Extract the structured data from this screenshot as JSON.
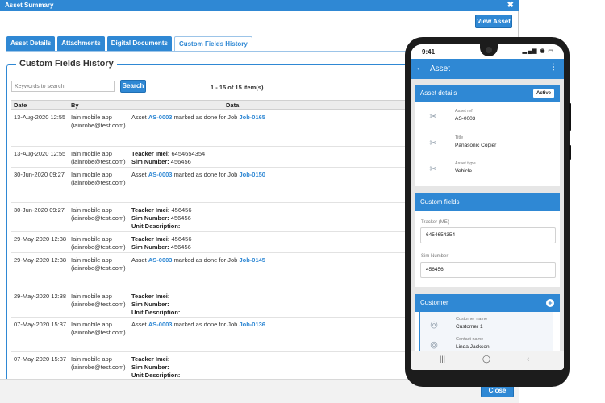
{
  "window": {
    "title": "Asset Summary",
    "view_asset_label": "View Asset",
    "close_label": "Close"
  },
  "tabs": [
    {
      "label": "Asset Details"
    },
    {
      "label": "Attachments"
    },
    {
      "label": "Digital Documents"
    },
    {
      "label": "Custom Fields History"
    }
  ],
  "history": {
    "section_title": "Custom Fields History",
    "search_placeholder": "Keywords to search",
    "search_label": "Search",
    "pager": "1 - 15 of 15 item(s)",
    "columns": {
      "date": "Date",
      "by": "By",
      "data": "Data"
    },
    "rows": [
      {
        "date": "13-Aug-2020 12:55",
        "by1": "Iain mobile app",
        "by2": "(iainrobe@test.com)",
        "pre": "Asset",
        "asset": "AS-0003",
        "mid": "marked as done for Job",
        "job": "Job-0165"
      },
      {
        "date": "13-Aug-2020 12:55",
        "by1": "Iain mobile app",
        "by2": "(iainrobe@test.com)",
        "l1k": "Teacker Imei:",
        "l1v": "6454654354",
        "l2k": "Sim Number:",
        "l2v": "456456"
      },
      {
        "date": "30-Jun-2020 09:27",
        "by1": "Iain mobile app",
        "by2": "(iainrobe@test.com)",
        "pre": "Asset",
        "asset": "AS-0003",
        "mid": "marked as done for Job",
        "job": "Job-0150"
      },
      {
        "date": "30-Jun-2020 09:27",
        "by1": "Iain mobile app",
        "by2": "(iainrobe@test.com)",
        "l1k": "Teacker Imei:",
        "l1v": "456456",
        "l2k": "Sim Number:",
        "l2v": "456456",
        "l3k": "Unit Description:"
      },
      {
        "date": "29-May-2020 12:38",
        "by1": "Iain mobile app",
        "by2": "(iainrobe@test.com)",
        "l1k": "Teacker Imei:",
        "l1v": "456456",
        "l2k": "Sim Number:",
        "l2v": "456456"
      },
      {
        "date": "29-May-2020 12:38",
        "by1": "Iain mobile app",
        "by2": "(iainrobe@test.com)",
        "pre": "Asset",
        "asset": "AS-0003",
        "mid": "marked as done for Job",
        "job": "Job-0145"
      },
      {
        "date": "29-May-2020 12:38",
        "by1": "Iain mobile app",
        "by2": "(iainrobe@test.com)",
        "l1k": "Teacker Imei:",
        "l2k": "Sim Number:",
        "l3k": "Unit Description:"
      },
      {
        "date": "07-May-2020 15:37",
        "by1": "Iain mobile app",
        "by2": "(iainrobe@test.com)",
        "pre": "Asset",
        "asset": "AS-0003",
        "mid": "marked as done for Job",
        "job": "Job-0136"
      },
      {
        "date": "07-May-2020 15:37",
        "by1": "Iain mobile app",
        "by2": "(iainrobe@test.com)",
        "l1k": "Teacker Imei:",
        "l2k": "Sim Number:",
        "l3k": "Unit Description:"
      }
    ]
  },
  "phone": {
    "time": "9:41",
    "app_title": "Asset",
    "asset_details": {
      "title": "Asset details",
      "badge": "Active",
      "items": [
        {
          "label": "Asset ref",
          "value": "AS-0003"
        },
        {
          "label": "Title",
          "value": "Panasonic Copier"
        },
        {
          "label": "Asset type",
          "value": "Vehicle"
        }
      ]
    },
    "custom_fields": {
      "title": "Custom fields",
      "fields": [
        {
          "label": "Tracker (ME)",
          "value": "6454654354"
        },
        {
          "label": "Sim Number",
          "value": "456456"
        }
      ]
    },
    "customer": {
      "title": "Customer",
      "items": [
        {
          "label": "Customer name",
          "value": "Customer 1"
        },
        {
          "label": "Contact name",
          "value": "Linda Jackson"
        }
      ]
    }
  }
}
